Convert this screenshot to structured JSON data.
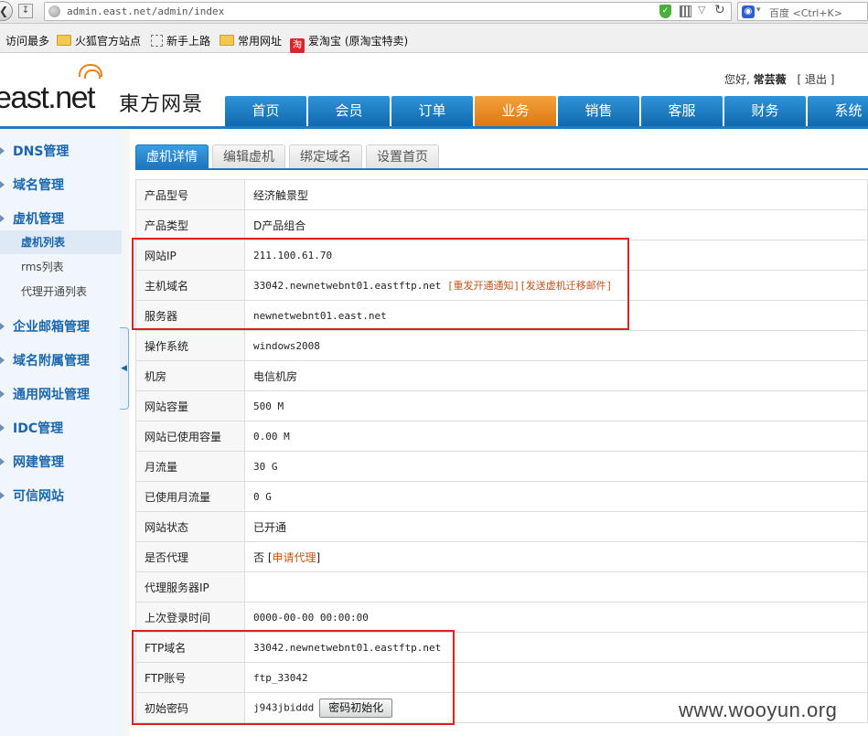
{
  "browser": {
    "url": "admin.east.net/admin/index",
    "search_placeholder": "百度 <Ctrl+K>",
    "bookmarks": [
      "访问最多",
      "火狐官方站点",
      "新手上路",
      "常用网址",
      "爱淘宝 (原淘宝特卖)"
    ]
  },
  "header": {
    "logo_text": "east.net",
    "logo_cn": "東方网景",
    "greeting_prefix": "您好,",
    "user_name": "常芸薇",
    "logout": "[ 退出 ]"
  },
  "nav": {
    "items": [
      "首页",
      "会员",
      "订单",
      "业务",
      "销售",
      "客服",
      "财务",
      "系统"
    ],
    "active": "业务"
  },
  "sidebar": {
    "sections": [
      {
        "label": "DNS管理"
      },
      {
        "label": "域名管理"
      },
      {
        "label": "虚机管理"
      },
      {
        "label": "企业邮箱管理"
      },
      {
        "label": "域名附属管理"
      },
      {
        "label": "通用网址管理"
      },
      {
        "label": "IDC管理"
      },
      {
        "label": "网建管理"
      },
      {
        "label": "可信网站"
      }
    ],
    "sub_items": [
      "虚机列表",
      "rms列表",
      "代理开通列表"
    ],
    "active_sub": "虚机列表"
  },
  "tabs": {
    "items": [
      "虚机详情",
      "编辑虚机",
      "绑定域名",
      "设置首页"
    ],
    "active": "虚机详情"
  },
  "details": {
    "rows": [
      {
        "label": "产品型号",
        "value": "经济触景型"
      },
      {
        "label": "产品类型",
        "value": "D产品组合"
      },
      {
        "label": "网站IP",
        "value": "211.100.61.70"
      },
      {
        "label": "主机域名",
        "value": "33042.newnetwebnt01.eastftp.net",
        "links": [
          "[重发开通通知]",
          "[发送虚机迁移邮件]"
        ]
      },
      {
        "label": "服务器",
        "value": "newnetwebnt01.east.net"
      },
      {
        "label": "操作系统",
        "value": "windows2008"
      },
      {
        "label": "机房",
        "value": "电信机房"
      },
      {
        "label": "网站容量",
        "value": "500 M"
      },
      {
        "label": "网站已使用容量",
        "value": "0.00 M"
      },
      {
        "label": "月流量",
        "value": "30 G"
      },
      {
        "label": "已使用月流量",
        "value": "0 G"
      },
      {
        "label": "网站状态",
        "value": "已开通"
      },
      {
        "label": "是否代理",
        "value": "否",
        "link": "申请代理"
      },
      {
        "label": "代理服务器IP",
        "value": ""
      },
      {
        "label": "上次登录时间",
        "value": "0000-00-00 00:00:00"
      },
      {
        "label": "FTP域名",
        "value": "33042.newnetwebnt01.eastftp.net"
      },
      {
        "label": "FTP账号",
        "value": "ftp_33042"
      },
      {
        "label": "初始密码",
        "value": "j943jbiddd",
        "button": "密码初始化"
      }
    ]
  },
  "watermark": "www.wooyun.org",
  "colors": {
    "nav_blue": "#1f7cc4",
    "nav_active_orange": "#e8891f",
    "sidebar_link": "#1a66ad",
    "highlight_red": "#e02020",
    "action_link_orange": "#c2541e"
  }
}
